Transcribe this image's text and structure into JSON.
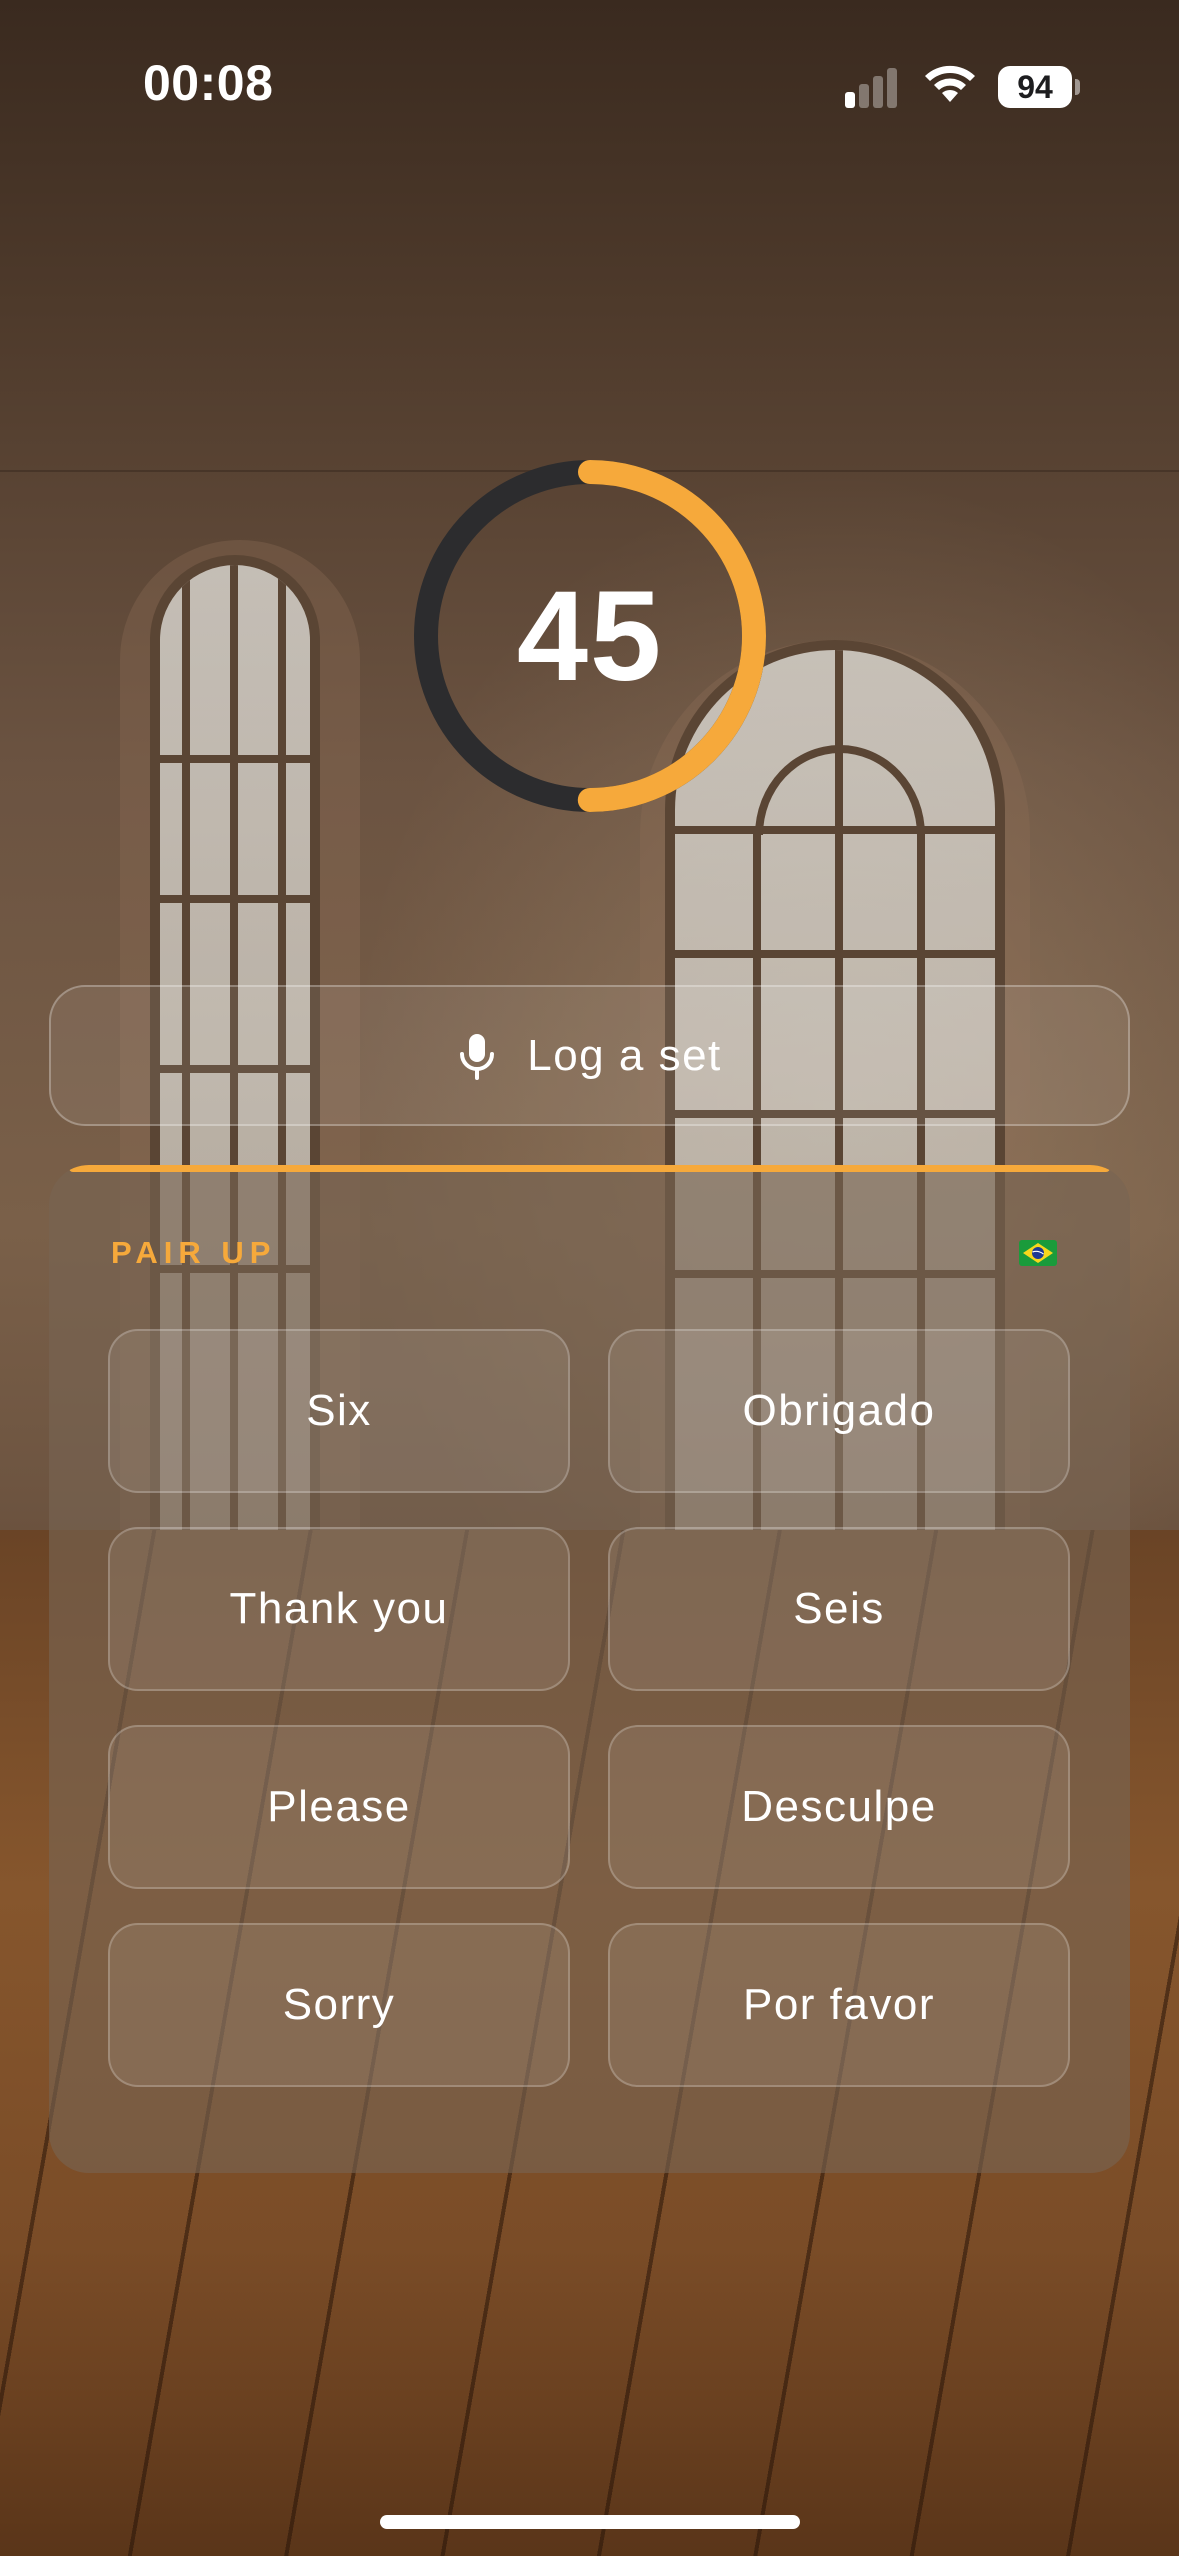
{
  "status_bar": {
    "time": "00:08",
    "battery_level": "94",
    "icons": [
      "cellular-signal-icon",
      "wifi-icon",
      "battery-icon"
    ]
  },
  "timer": {
    "value": "45",
    "progress_fraction": 0.5,
    "accent_color": "#f6a93b",
    "track_color": "#2c2c2e"
  },
  "log_button": {
    "label": "Log a set",
    "icon": "microphone-icon"
  },
  "pair_up": {
    "title": "PAIR UP",
    "flag_icon": "brazil-flag-icon",
    "accent_color": "#f6a93b",
    "words": [
      "Six",
      "Obrigado",
      "Thank you",
      "Seis",
      "Please",
      "Desculpe",
      "Sorry",
      "Por favor"
    ]
  }
}
